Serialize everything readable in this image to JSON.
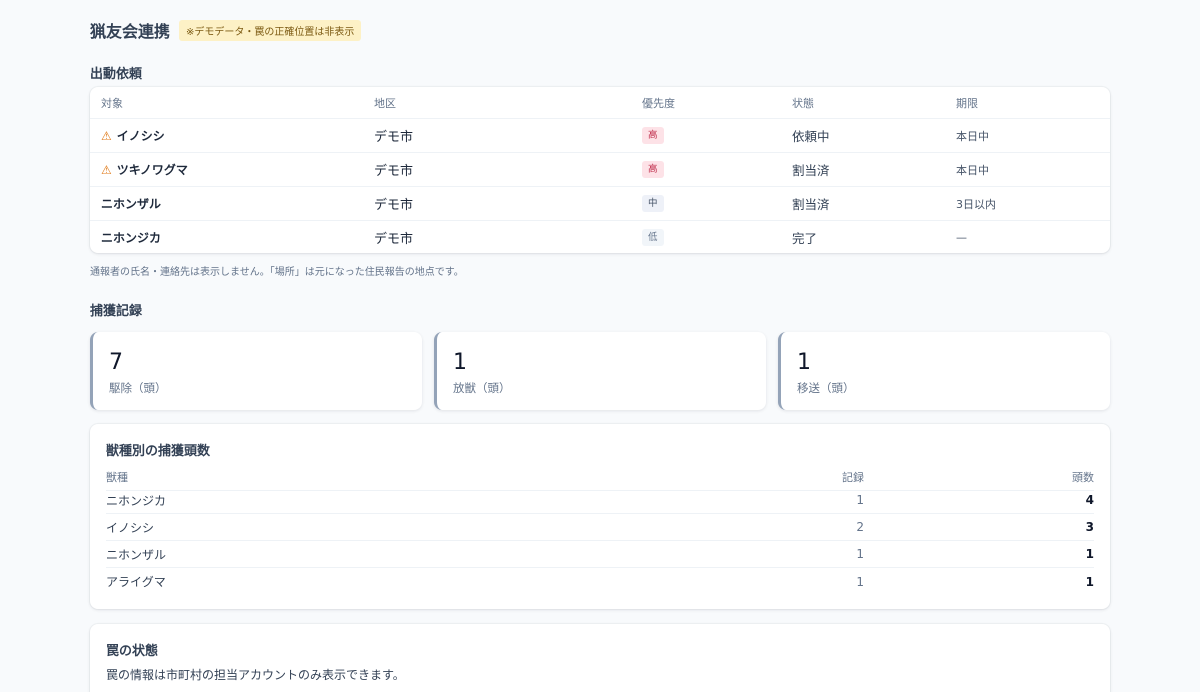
{
  "header": {
    "title": "猟友会連携",
    "badge": "※デモデータ・罠の正確位置は非表示"
  },
  "requests": {
    "section_title": "出動依頼",
    "columns": [
      "対象",
      "地区",
      "優先度",
      "状態",
      "期限"
    ],
    "rows": [
      {
        "warning": true,
        "target": "イノシシ",
        "area": "デモ市",
        "priority": "高",
        "priority_level": "high",
        "status": "依頼中",
        "deadline": "本日中"
      },
      {
        "warning": true,
        "target": "ツキノワグマ",
        "area": "デモ市",
        "priority": "高",
        "priority_level": "high",
        "status": "割当済",
        "deadline": "本日中"
      },
      {
        "warning": false,
        "target": "ニホンザル",
        "area": "デモ市",
        "priority": "中",
        "priority_level": "mid",
        "status": "割当済",
        "deadline": "3日以内"
      },
      {
        "warning": false,
        "target": "ニホンジカ",
        "area": "デモ市",
        "priority": "低",
        "priority_level": "low",
        "status": "完了",
        "deadline": "—"
      }
    ],
    "note": "通報者の氏名・連絡先は表示しません。「場所」は元になった住民報告の地点です。"
  },
  "captures": {
    "section_title": "捕獲記録",
    "stats": [
      {
        "value": "7",
        "label": "駆除（頭）"
      },
      {
        "value": "1",
        "label": "放獣（頭）"
      },
      {
        "value": "1",
        "label": "移送（頭）"
      }
    ]
  },
  "species": {
    "title": "獣種別の捕獲頭数",
    "columns": [
      "獣種",
      "記録",
      "頭数"
    ],
    "rows": [
      {
        "name": "ニホンジカ",
        "records": "1",
        "heads": "4"
      },
      {
        "name": "イノシシ",
        "records": "2",
        "heads": "3"
      },
      {
        "name": "ニホンザル",
        "records": "1",
        "heads": "1"
      },
      {
        "name": "アライグマ",
        "records": "1",
        "heads": "1"
      }
    ]
  },
  "traps": {
    "title": "罠の状態",
    "text": "罠の情報は市町村の担当アカウントのみ表示できます。"
  },
  "icons": {
    "warning": "warning-triangle-icon"
  },
  "colors": {
    "priority_high_bg": "#fde2e7",
    "priority_high_text": "#be2a48",
    "badge_bg": "#fdf1c6",
    "stat_border": "#94a3b8"
  }
}
